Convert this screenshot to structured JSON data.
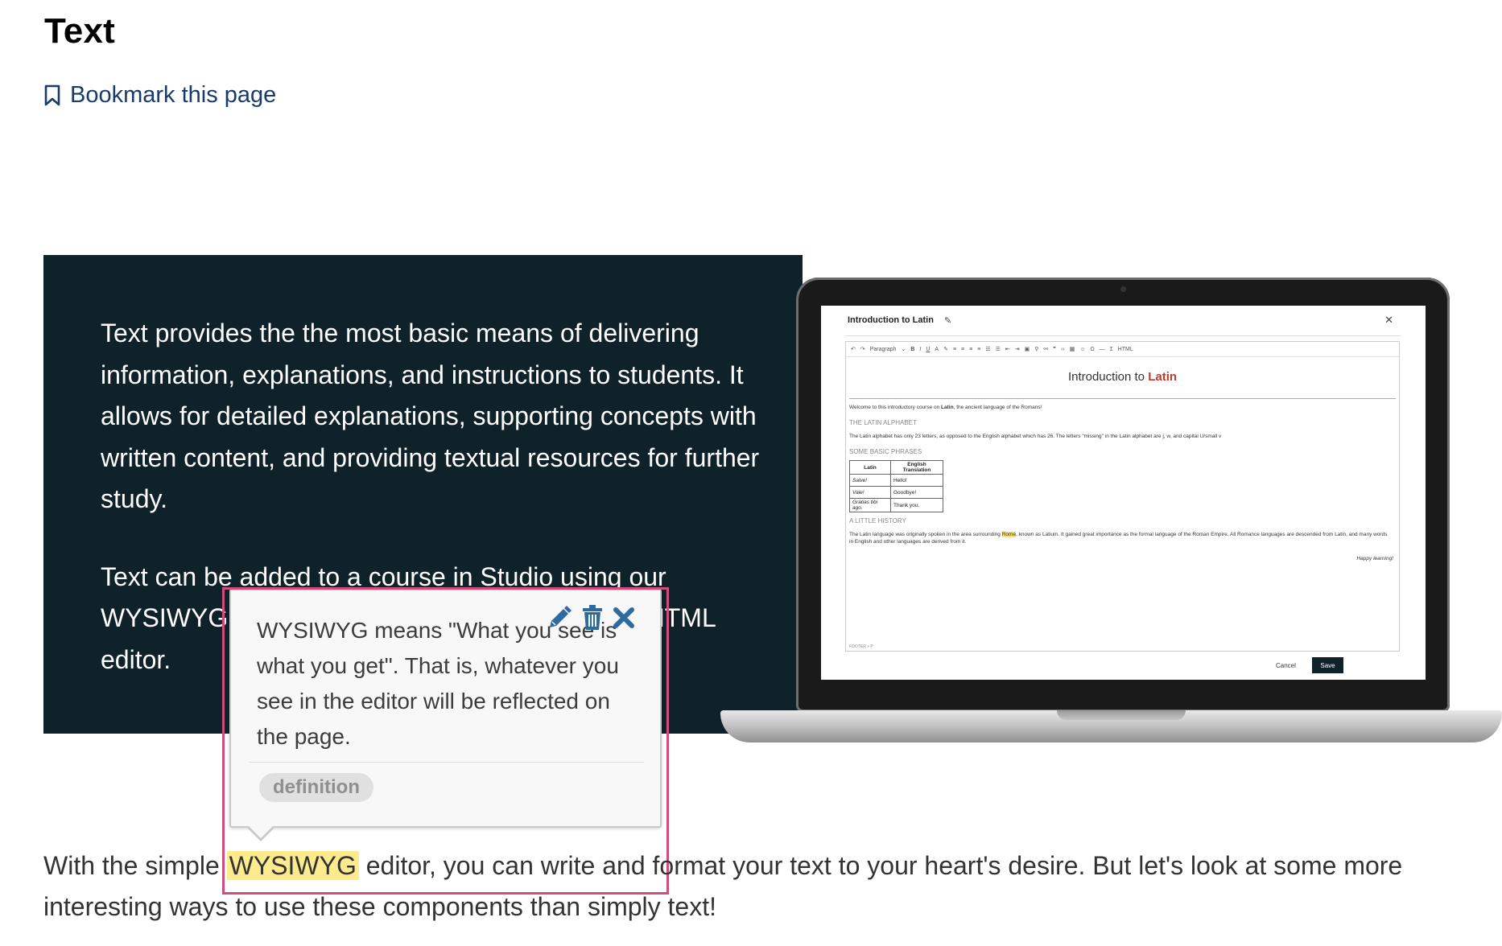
{
  "page": {
    "title": "Text",
    "bookmark_label": "Bookmark this page"
  },
  "banner": {
    "paragraph_1": "Text provides the the most basic means of delivering information, explanations, and instructions to students. It allows for detailed explanations, supporting concepts with written content, and providing textual resources for further study.",
    "paragraph_2": "Text can be added to a course in Studio using our WYSIWYG (What You See Is What You Get) or HTML editor.",
    "background": "#0f2229"
  },
  "laptop_editor": {
    "dialog_title": "Introduction to Latin",
    "toolbar_format": "Paragraph",
    "toolbar_html": "HTML",
    "doc_title_prefix": "Introduction to ",
    "doc_title_emph": "Latin",
    "welcome_prefix": "Welcome to this introductory course on ",
    "welcome_bold": "Latin",
    "welcome_suffix": ", the ancient language of the Romans!",
    "heading_alphabet": "THE LATIN ALPHABET",
    "alphabet_text": "The Latin alphabet has only 23 letters, as opposed to the English alphabet which has 26. The letters \"missing\" in the Latin alphabet are j, w, and capital U/small v",
    "heading_phrases": "SOME BASIC PHRASES",
    "table_headers": [
      "Latin",
      "English Translation"
    ],
    "table_rows": [
      [
        "Salve!",
        "Hello!"
      ],
      [
        "Vale!",
        "Goodbye!"
      ],
      [
        "Gratias tibi ago.",
        "Thank you."
      ]
    ],
    "heading_history": "A LITTLE HISTORY",
    "history_prefix": "The Latin language was originally spoken in the area surrounding ",
    "history_hl": "Rome",
    "history_suffix": ", known as Latium. It gained great importance as the formal language of the Roman Empire. All Romance languages are descended from Latin, and many words in English and other languages are derived from it.",
    "signoff": "Happy learning!",
    "footer": "FOOTER » P",
    "cancel_label": "Cancel",
    "save_label": "Save"
  },
  "popover": {
    "definition": "WYSIWYG means \"What you see is what you get\". That is, whatever you see in the editor will be reflected on the page.",
    "tag": "definition",
    "icons": [
      "pencil-icon",
      "trash-icon",
      "close-icon"
    ],
    "icon_color": "#2c6aa0",
    "frame_color": "#d04d7e"
  },
  "body": {
    "before": "With the simple ",
    "term": "WYSIWYG",
    "after": " editor, you can write and format your text to your heart's desire. But let's look at some more interesting ways to use these components than simply text!",
    "highlight_color": "#fdeb8d"
  }
}
